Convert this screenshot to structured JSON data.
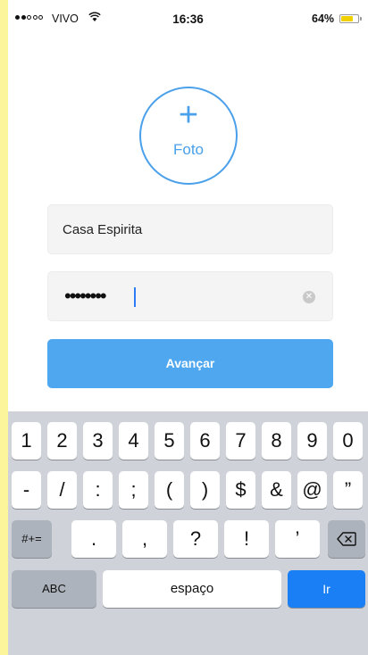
{
  "status_bar": {
    "carrier": "VIVO",
    "time": "16:36",
    "battery": "64%",
    "battery_level": 0.64
  },
  "photo": {
    "icon": "plus-icon",
    "label": "Foto"
  },
  "form": {
    "name_value": "Casa Espirita",
    "password_dots": "••••••••",
    "submit_label": "Avançar"
  },
  "keyboard": {
    "row1": [
      "1",
      "2",
      "3",
      "4",
      "5",
      "6",
      "7",
      "8",
      "9",
      "0"
    ],
    "row2": [
      "-",
      "/",
      ":",
      ";",
      "(",
      ")",
      "$",
      "&",
      "@",
      "”"
    ],
    "row3": {
      "mode": "#+=",
      "keys": [
        ".",
        ",",
        "?",
        "!",
        "’"
      ],
      "backspace_icon": "backspace-icon"
    },
    "row4": {
      "abc": "ABC",
      "space": "espaço",
      "go": "Ir"
    }
  },
  "colors": {
    "accent": "#4ea7ef",
    "outline": "#4aa0ea",
    "go_key": "#1a7ff5",
    "frame": "#fdf59c",
    "keyboard_bg": "#cfd3d9"
  }
}
